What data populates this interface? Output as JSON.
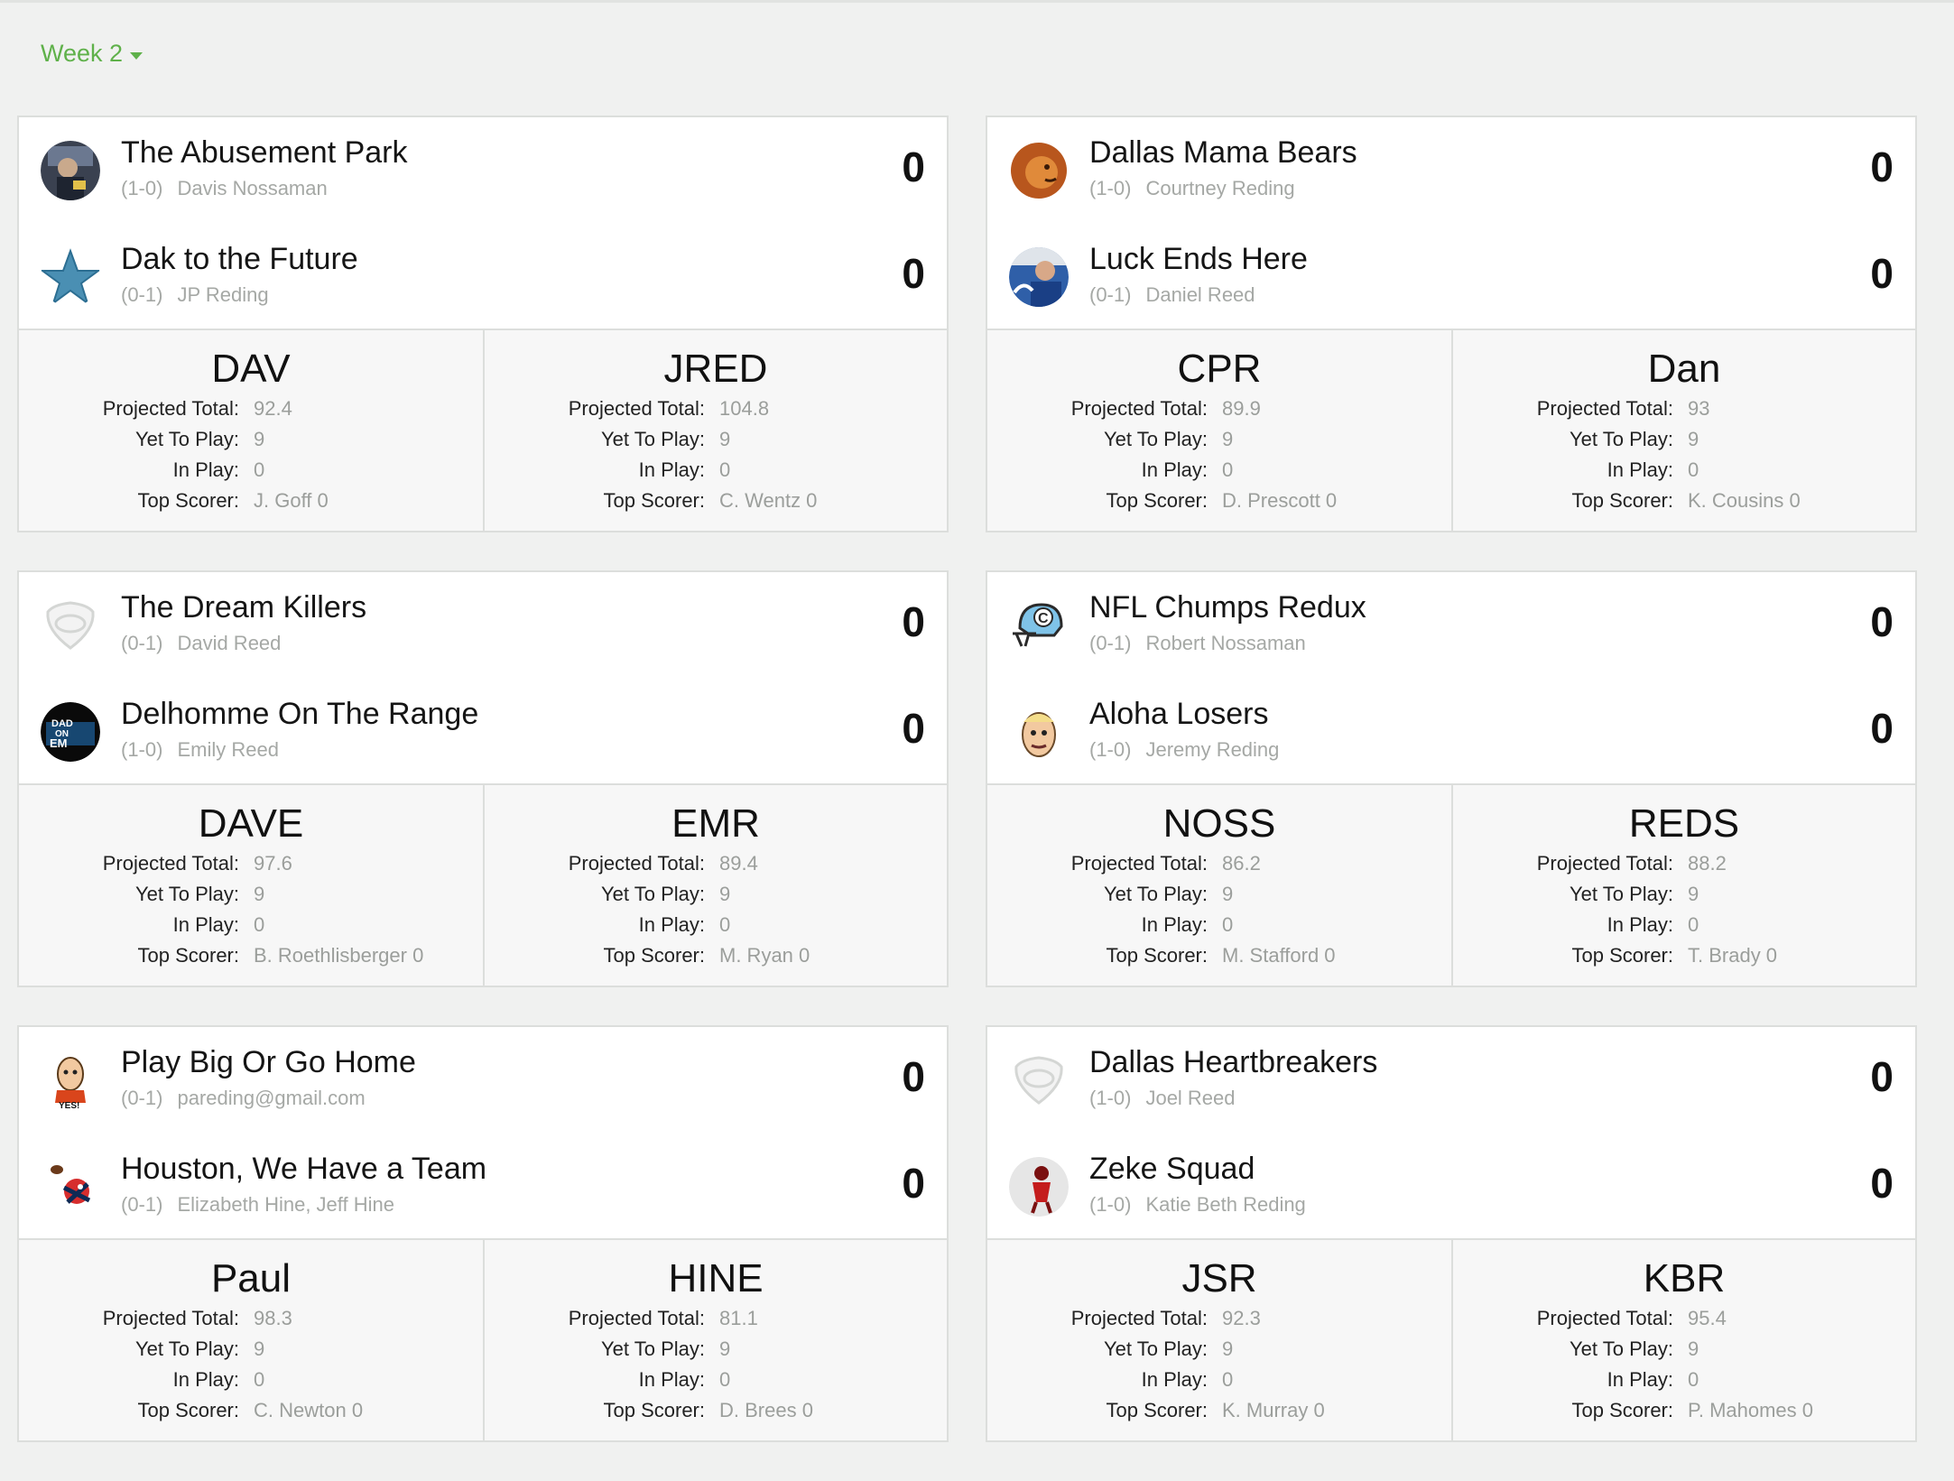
{
  "week": {
    "label": "Week 2"
  },
  "stat_labels": {
    "projected": "Projected Total:",
    "yet": "Yet To Play:",
    "inplay": "In Play:",
    "top": "Top Scorer:"
  },
  "matchups": [
    {
      "teams": [
        {
          "name": "The Abusement Park",
          "record": "(1-0)",
          "owner": "Davis Nossaman",
          "score": "0",
          "icon": "team-photo-icon"
        },
        {
          "name": "Dak to the Future",
          "record": "(0-1)",
          "owner": "JP Reding",
          "score": "0",
          "icon": "star-icon"
        }
      ],
      "stats": [
        {
          "abbr": "DAV",
          "projected": "92.4",
          "yet": "9",
          "inplay": "0",
          "top": "J. Goff 0"
        },
        {
          "abbr": "JRED",
          "projected": "104.8",
          "yet": "9",
          "inplay": "0",
          "top": "C. Wentz 0"
        }
      ]
    },
    {
      "teams": [
        {
          "name": "Dallas Mama Bears",
          "record": "(1-0)",
          "owner": "Courtney Reding",
          "score": "0",
          "icon": "lion-icon"
        },
        {
          "name": "Luck Ends Here",
          "record": "(0-1)",
          "owner": "Daniel Reed",
          "score": "0",
          "icon": "player-photo-icon"
        }
      ],
      "stats": [
        {
          "abbr": "CPR",
          "projected": "89.9",
          "yet": "9",
          "inplay": "0",
          "top": "D. Prescott 0"
        },
        {
          "abbr": "Dan",
          "projected": "93",
          "yet": "9",
          "inplay": "0",
          "top": "K. Cousins 0"
        }
      ]
    },
    {
      "teams": [
        {
          "name": "The Dream Killers",
          "record": "(0-1)",
          "owner": "David Reed",
          "score": "0",
          "icon": "default-shield-icon"
        },
        {
          "name": "Delhomme On The Range",
          "record": "(1-0)",
          "owner": "Emily Reed",
          "score": "0",
          "icon": "dad-on-em-logo-icon",
          "logo_text": [
            "DAD",
            "ON",
            "EM"
          ]
        }
      ],
      "stats": [
        {
          "abbr": "DAVE",
          "projected": "97.6",
          "yet": "9",
          "inplay": "0",
          "top": "B. Roethlisberger 0"
        },
        {
          "abbr": "EMR",
          "projected": "89.4",
          "yet": "9",
          "inplay": "0",
          "top": "M. Ryan 0"
        }
      ]
    },
    {
      "teams": [
        {
          "name": "NFL Chumps Redux",
          "record": "(0-1)",
          "owner": "Robert Nossaman",
          "score": "0",
          "icon": "helmet-icon",
          "logo_text": [
            "C"
          ]
        },
        {
          "name": "Aloha Losers",
          "record": "(1-0)",
          "owner": "Jeremy Reding",
          "score": "0",
          "icon": "cartoon-face-icon"
        }
      ],
      "stats": [
        {
          "abbr": "NOSS",
          "projected": "86.2",
          "yet": "9",
          "inplay": "0",
          "top": "M. Stafford 0"
        },
        {
          "abbr": "REDS",
          "projected": "88.2",
          "yet": "9",
          "inplay": "0",
          "top": "T. Brady 0"
        }
      ]
    },
    {
      "teams": [
        {
          "name": "Play Big Or Go Home",
          "record": "(0-1)",
          "owner": "pareding@gmail.com",
          "score": "0",
          "icon": "yes-cartoon-icon",
          "logo_text": [
            "YES!"
          ]
        },
        {
          "name": "Houston, We Have a Team",
          "record": "(0-1)",
          "owner": "Elizabeth Hine, Jeff Hine",
          "score": "0",
          "icon": "mascot-icon"
        }
      ],
      "stats": [
        {
          "abbr": "Paul",
          "projected": "98.3",
          "yet": "9",
          "inplay": "0",
          "top": "C. Newton 0"
        },
        {
          "abbr": "HINE",
          "projected": "81.1",
          "yet": "9",
          "inplay": "0",
          "top": "D. Brees 0"
        }
      ]
    },
    {
      "teams": [
        {
          "name": "Dallas Heartbreakers",
          "record": "(1-0)",
          "owner": "Joel Reed",
          "score": "0",
          "icon": "default-shield-icon"
        },
        {
          "name": "Zeke Squad",
          "record": "(1-0)",
          "owner": "Katie Beth Reding",
          "score": "0",
          "icon": "red-figure-icon"
        }
      ],
      "stats": [
        {
          "abbr": "JSR",
          "projected": "92.3",
          "yet": "9",
          "inplay": "0",
          "top": "K. Murray 0"
        },
        {
          "abbr": "KBR",
          "projected": "95.4",
          "yet": "9",
          "inplay": "0",
          "top": "P. Mahomes 0"
        }
      ]
    }
  ]
}
